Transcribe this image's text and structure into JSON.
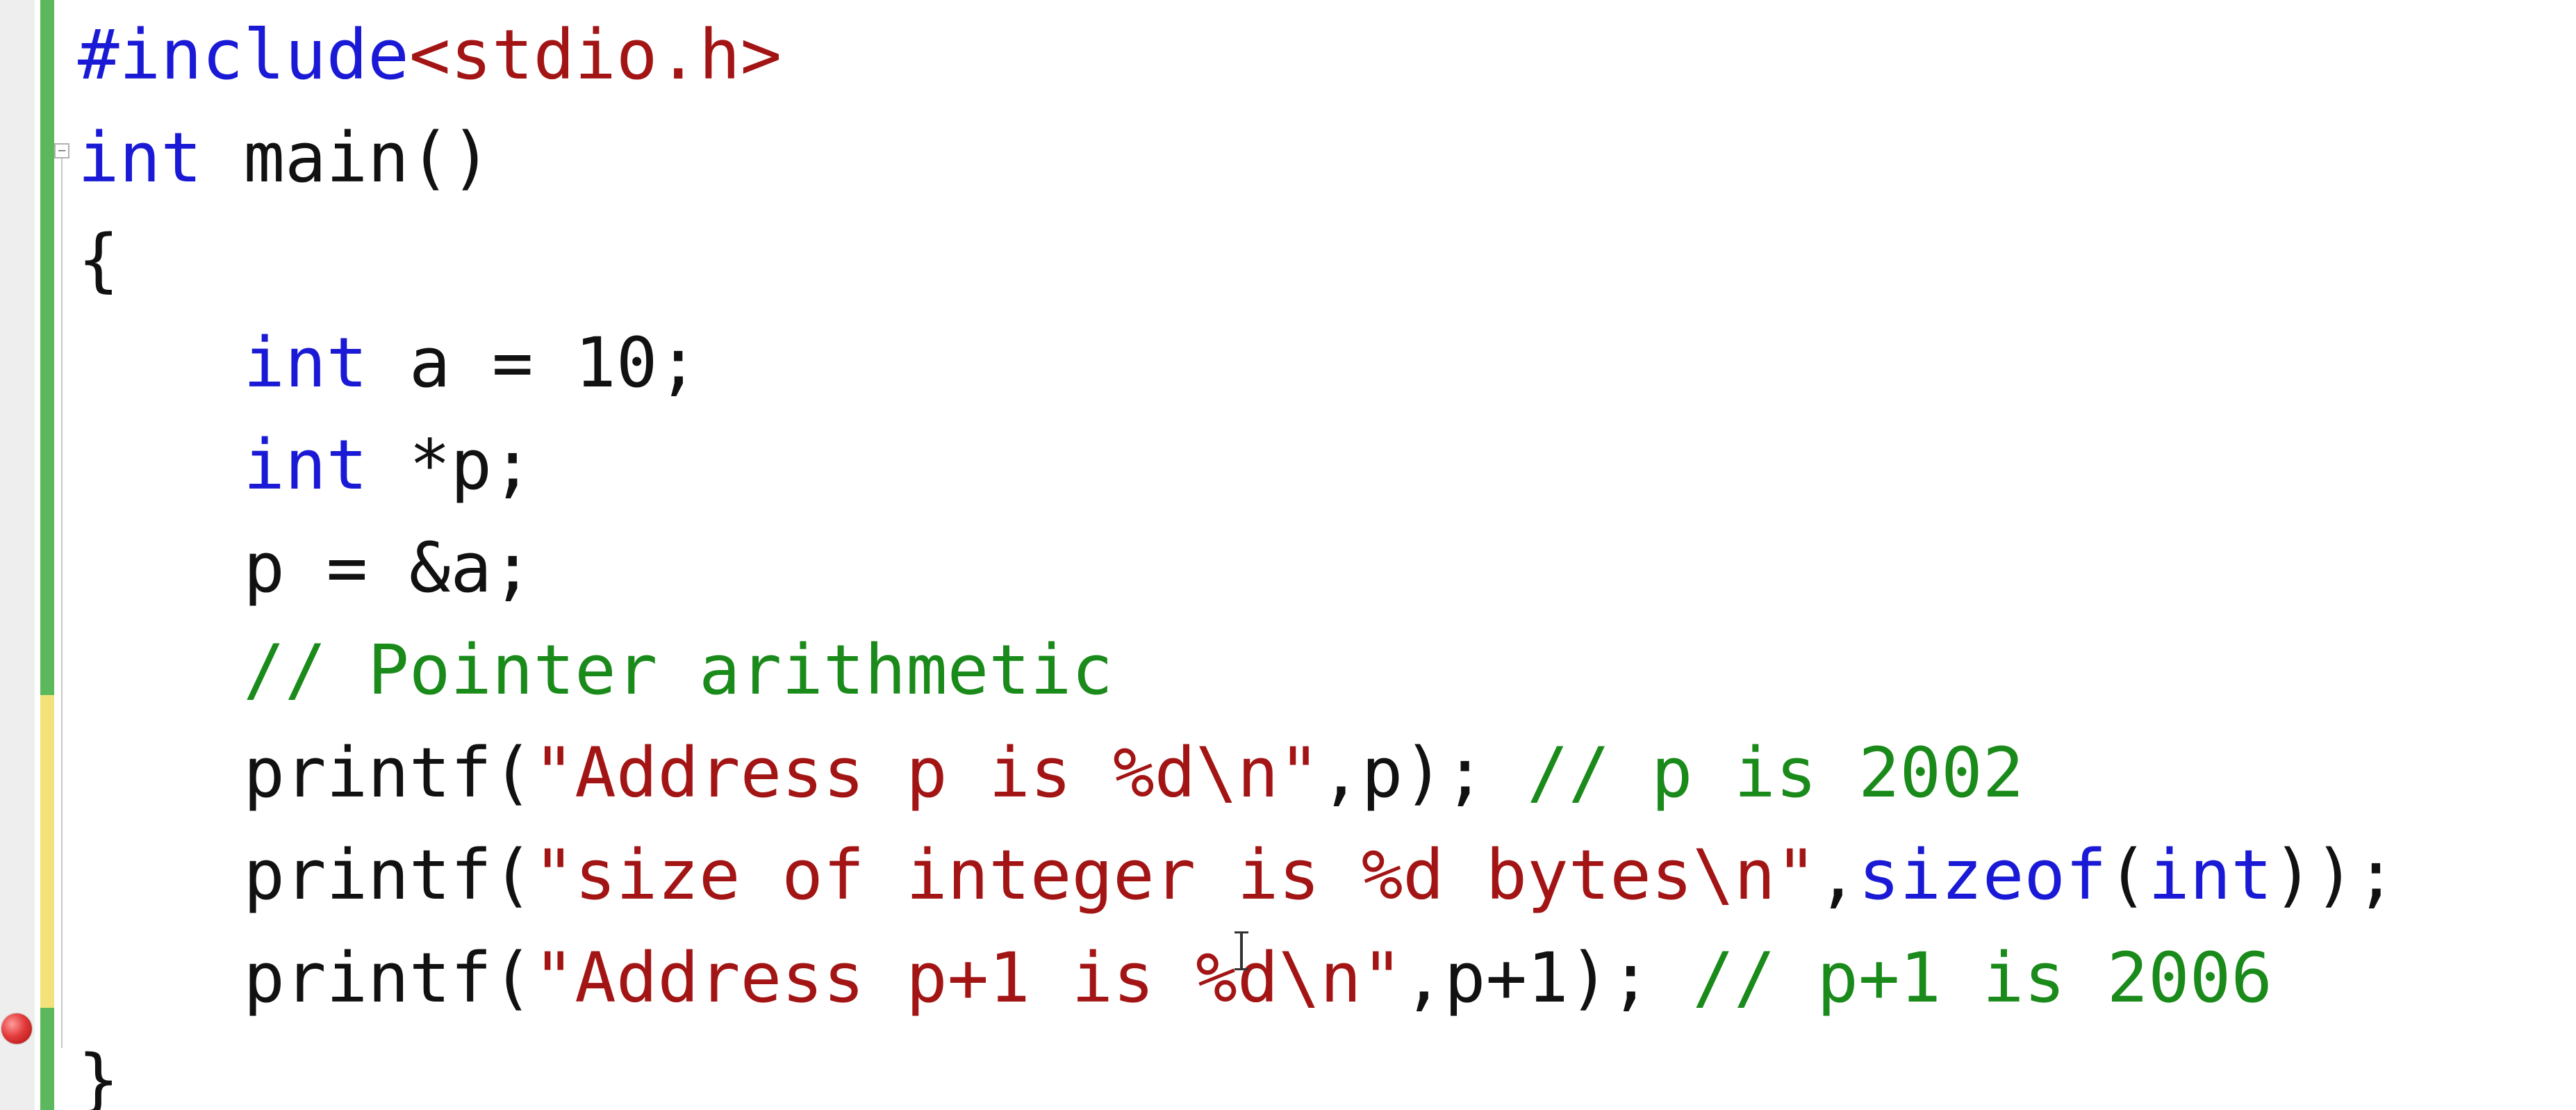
{
  "colors": {
    "keyword": "#1a1ad6",
    "string": "#a31515",
    "comment": "#1a8a1a",
    "text": "#111111",
    "change_saved": "#5cb85c",
    "change_unsaved": "#f3e27a",
    "breakpoint": "#e33b3b"
  },
  "gutter": {
    "collapse_icon": "minus-box-icon",
    "breakpoint_icon": "breakpoint-icon"
  },
  "code": {
    "lines": [
      {
        "tokens": [
          {
            "type": "pp",
            "text": "#include"
          },
          {
            "type": "hdr",
            "text": "<stdio.h>"
          }
        ]
      },
      {
        "tokens": [
          {
            "type": "kw",
            "text": "int"
          },
          {
            "type": "txt",
            "text": " main()"
          }
        ]
      },
      {
        "tokens": [
          {
            "type": "txt",
            "text": "{"
          }
        ]
      },
      {
        "tokens": [
          {
            "type": "txt",
            "text": "    "
          },
          {
            "type": "kw",
            "text": "int"
          },
          {
            "type": "txt",
            "text": " a = 10;"
          }
        ]
      },
      {
        "tokens": [
          {
            "type": "txt",
            "text": "    "
          },
          {
            "type": "kw",
            "text": "int"
          },
          {
            "type": "txt",
            "text": " *p;"
          }
        ]
      },
      {
        "tokens": [
          {
            "type": "txt",
            "text": "    p = &a;"
          }
        ]
      },
      {
        "tokens": [
          {
            "type": "txt",
            "text": "    "
          },
          {
            "type": "cm",
            "text": "// Pointer arithmetic"
          }
        ]
      },
      {
        "tokens": [
          {
            "type": "txt",
            "text": "    printf("
          },
          {
            "type": "str",
            "text": "\"Address p is %d\\n\""
          },
          {
            "type": "txt",
            "text": ",p); "
          },
          {
            "type": "cm",
            "text": "// p is 2002"
          }
        ]
      },
      {
        "tokens": [
          {
            "type": "txt",
            "text": "    printf("
          },
          {
            "type": "str",
            "text": "\"size of integer is %d bytes\\n\""
          },
          {
            "type": "txt",
            "text": ","
          },
          {
            "type": "kw",
            "text": "sizeof"
          },
          {
            "type": "txt",
            "text": "("
          },
          {
            "type": "kw",
            "text": "int"
          },
          {
            "type": "txt",
            "text": "));"
          }
        ]
      },
      {
        "tokens": [
          {
            "type": "txt",
            "text": "    printf("
          },
          {
            "type": "str",
            "text": "\"Address p+1 is %d\\n\""
          },
          {
            "type": "txt",
            "text": ",p+1); "
          },
          {
            "type": "cm",
            "text": "// p+1 is 2006"
          }
        ]
      },
      {
        "tokens": [
          {
            "type": "txt",
            "text": "}"
          }
        ]
      }
    ]
  }
}
